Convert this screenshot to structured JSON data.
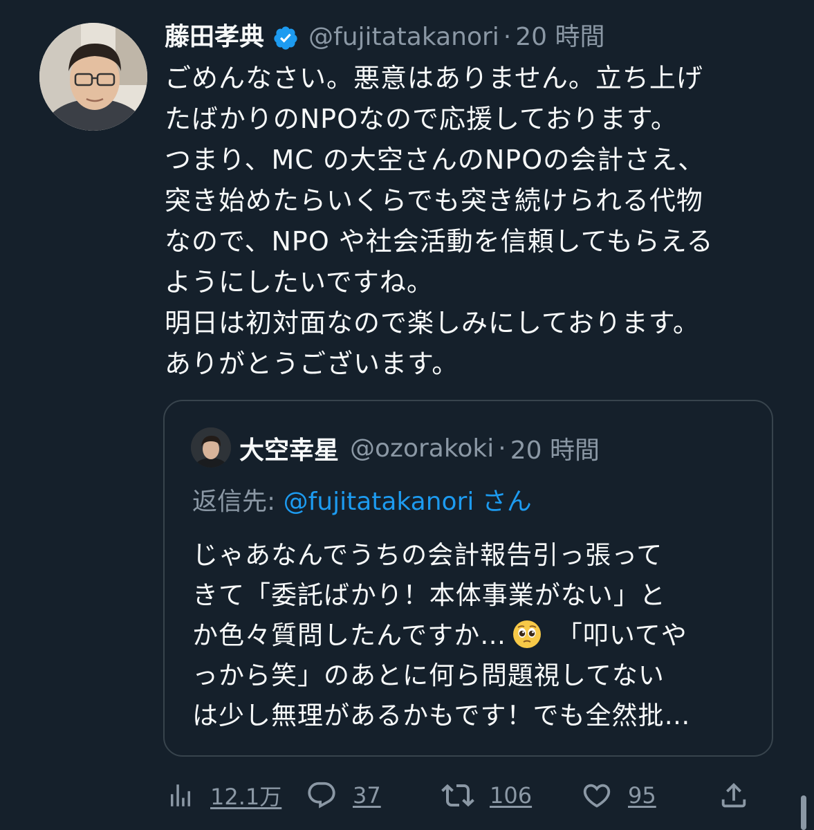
{
  "tweet": {
    "author_name": "藤田孝典",
    "author_handle": "@fujitatakanori",
    "separator": "·",
    "time": "20 時間",
    "body_lines": [
      "ごめんなさい。悪意はありません。立ち上げ",
      "たばかりのNPOなので応援しております。",
      "つまり、MC の大空さんのNPOの会計さえ、",
      "突き始めたらいくらでも突き続けられる代物",
      "なので、NPO や社会活動を信頼してもらえる",
      "ようにしたいですね。",
      "明日は初対面なので楽しみにしております。",
      "ありがとうございます。"
    ]
  },
  "quote": {
    "author_name": "大空幸星",
    "author_handle": "@ozorakoki",
    "separator": "·",
    "time": "20 時間",
    "reply_prefix": "返信先: ",
    "reply_mention": "@fujitatakanori",
    "reply_suffix": " さん",
    "text_lines": [
      "じゃあなんでうちの会計報告引っ張って",
      "きて「委託ばかり！本体事業がない」と",
      "か色々質問したんですか…",
      " 「叩いてや",
      "っから笑」のあとに何ら問題視してない",
      "は少し無理があるかもです！でも全然批…"
    ]
  },
  "actions": {
    "views": "12.1万",
    "replies": "37",
    "retweets": "106",
    "likes": "95"
  },
  "colors": {
    "background": "#15202b",
    "text": "#f7f9f9",
    "secondary": "#8b98a5",
    "accent": "#1d9bf0",
    "border": "#38444d"
  },
  "icons": [
    "verified-badge-icon",
    "views-icon",
    "reply-icon",
    "retweet-icon",
    "like-icon",
    "share-icon",
    "pleading-face-emoji"
  ]
}
